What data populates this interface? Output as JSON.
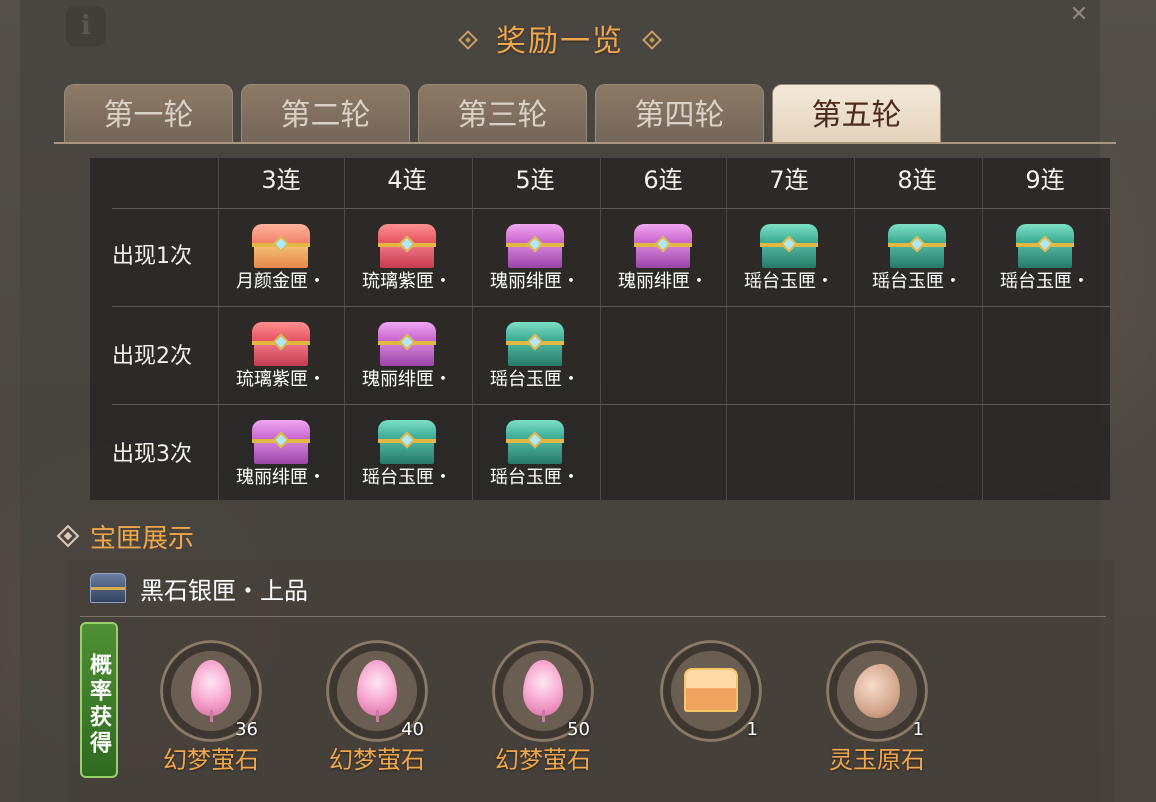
{
  "title": "奖励一览",
  "tabs": [
    "第一轮",
    "第二轮",
    "第三轮",
    "第四轮",
    "第五轮"
  ],
  "active_tab": "第五轮",
  "table": {
    "columns": [
      "3连",
      "4连",
      "5连",
      "6连",
      "7连",
      "8连",
      "9连"
    ],
    "rows": [
      {
        "label": "出现1次",
        "cells": [
          {
            "name": "月颜金匣・",
            "color": "gold"
          },
          {
            "name": "琉璃紫匣・",
            "color": "red"
          },
          {
            "name": "瑰丽绯匣・",
            "color": "purple"
          },
          {
            "name": "瑰丽绯匣・",
            "color": "purple"
          },
          {
            "name": "瑶台玉匣・",
            "color": "jade"
          },
          {
            "name": "瑶台玉匣・",
            "color": "jade"
          },
          {
            "name": "瑶台玉匣・",
            "color": "jade"
          }
        ]
      },
      {
        "label": "出现2次",
        "cells": [
          {
            "name": "琉璃紫匣・",
            "color": "red"
          },
          {
            "name": "瑰丽绯匣・",
            "color": "purple"
          },
          {
            "name": "瑶台玉匣・",
            "color": "jade"
          }
        ]
      },
      {
        "label": "出现3次",
        "cells": [
          {
            "name": "瑰丽绯匣・",
            "color": "purple"
          },
          {
            "name": "瑶台玉匣・",
            "color": "jade"
          },
          {
            "name": "瑶台玉匣・",
            "color": "jade"
          }
        ]
      }
    ]
  },
  "showcase": {
    "section_title": "宝匣展示",
    "chest_name": "黑石银匣・上品",
    "prob_label": "概率获得",
    "rewards": [
      {
        "name": "幻梦萤石",
        "count": "36",
        "icon": "leaf"
      },
      {
        "name": "幻梦萤石",
        "count": "40",
        "icon": "leaf"
      },
      {
        "name": "幻梦萤石",
        "count": "50",
        "icon": "leaf"
      },
      {
        "name": "",
        "count": "1",
        "icon": "box"
      },
      {
        "name": "灵玉原石",
        "count": "1",
        "icon": "stone"
      }
    ]
  },
  "colors": {
    "accent_orange": "#f0a64a",
    "prob_green": "#4f8f34"
  }
}
